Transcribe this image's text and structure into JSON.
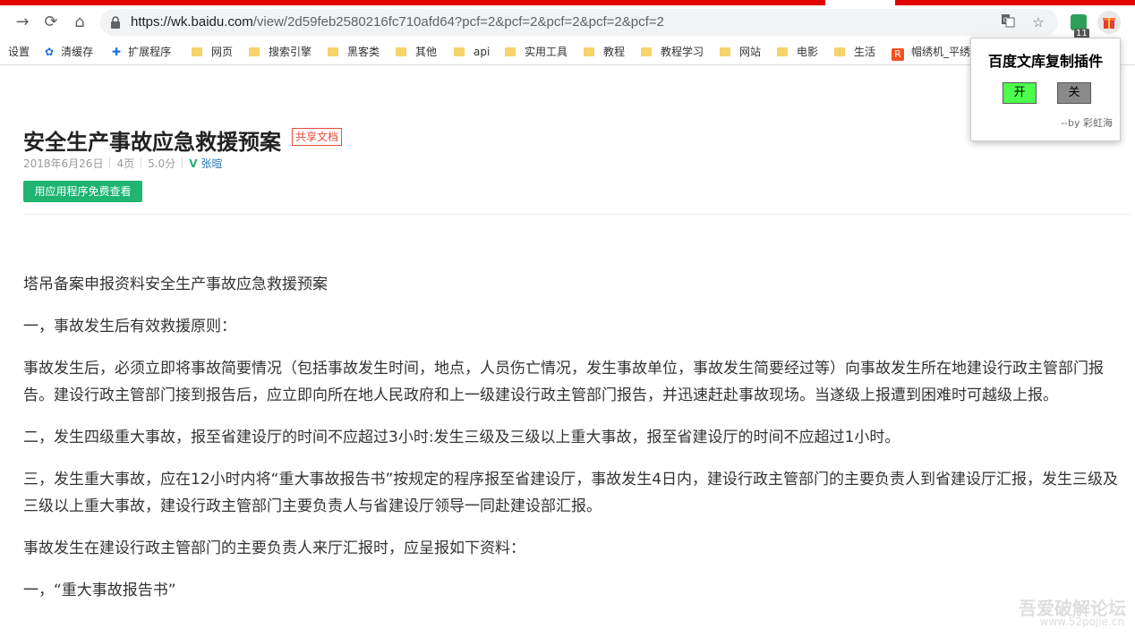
{
  "browser": {
    "url_host": "https://wk.baidu.com",
    "url_path": "/view/2d59feb2580216fc710afd64?pcf=2&pcf=2&pcf=2&pcf=2&pcf=2",
    "extension_badge": "11"
  },
  "bookmarks": [
    {
      "label": "设置",
      "icon": "none"
    },
    {
      "label": "清缓存",
      "icon": "gear-icon"
    },
    {
      "label": "扩展程序",
      "icon": "puzzle-icon"
    },
    {
      "label": "网页",
      "icon": "folder-icon"
    },
    {
      "label": "搜索引擎",
      "icon": "folder-icon"
    },
    {
      "label": "黑客类",
      "icon": "folder-icon"
    },
    {
      "label": "其他",
      "icon": "folder-icon"
    },
    {
      "label": "api",
      "icon": "folder-icon"
    },
    {
      "label": "实用工具",
      "icon": "folder-icon"
    },
    {
      "label": "教程",
      "icon": "folder-icon"
    },
    {
      "label": "教程学习",
      "icon": "folder-icon"
    },
    {
      "label": "网站",
      "icon": "folder-icon"
    },
    {
      "label": "电影",
      "icon": "folder-icon"
    },
    {
      "label": "生活",
      "icon": "folder-icon"
    },
    {
      "label": "帽绣机_平绣",
      "icon": "rss-icon"
    }
  ],
  "document": {
    "title": "安全生产事故应急救援预案",
    "tag": "共享文档",
    "date": "2018年6月26日",
    "pages": "4页",
    "score": "5.0分",
    "author": "张暄",
    "app_button": "用应用程序免费查看",
    "paragraphs": [
      "塔吊备案申报资料安全生产事故应急救援预案",
      "一，事故发生后有效救援原则：",
      "事故发生后，必须立即将事故简要情况（包括事故发生时间，地点，人员伤亡情况，发生事故单位，事故发生简要经过等）向事故发生所在地建设行政主管部门报告。建设行政主管部门接到报告后，应立即向所在地人民政府和上一级建设行政主管部门报告，并迅速赶赴事故现场。当遂级上报遭到困难时可越级上报。",
      "二，发生四级重大事故，报至省建设厅的时间不应超过3小时:发生三级及三级以上重大事故，报至省建设厅的时间不应超过1小时。",
      "三，发生重大事故，应在12小时内将“重大事故报告书”按规定的程序报至省建设厅，事故发生4日内，建设行政主管部门的主要负责人到省建设厅汇报，发生三级及三级以上重大事故，建设行政主管部门主要负责人与省建设厅领导一同赴建设部汇报。",
      "事故发生在建设行政主管部门的主要负责人来厅汇报时，应呈报如下资料：",
      "一，“重大事故报告书”"
    ]
  },
  "popup": {
    "title": "百度文库复制插件",
    "on_label": "开",
    "off_label": "关",
    "byline": "--by 彩虹海"
  },
  "watermark": {
    "line1": "吾爱破解论坛",
    "line2": "www.52pojie.cn"
  },
  "colors": {
    "accent_green": "#1fb472",
    "tag_red": "#e74c3c",
    "top_strip_red": "#e00000",
    "on_button": "#4cff4c",
    "off_button": "#8a8a8a"
  }
}
